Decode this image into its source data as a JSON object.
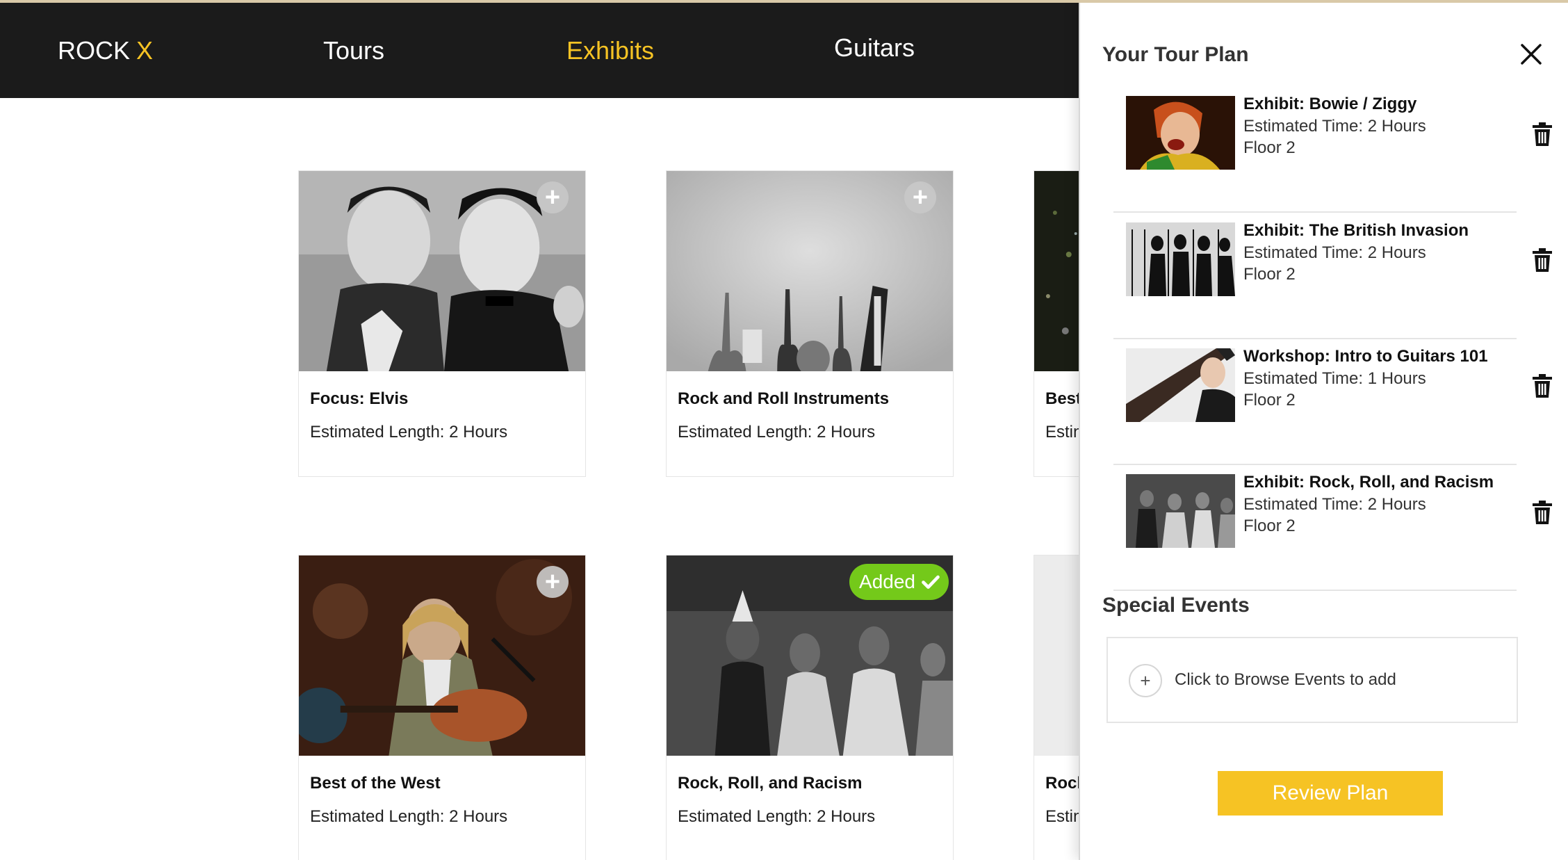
{
  "nav": {
    "logo_text": "ROCK",
    "logo_accent": "X",
    "items": [
      "Tours",
      "Exhibits",
      "Guitars"
    ],
    "active": "Exhibits",
    "accent_color": "#f6c324"
  },
  "cards": [
    {
      "title": "Focus: Elvis",
      "length": "Estimated Length: 2 Hours",
      "status": "add",
      "icon": "plus-icon"
    },
    {
      "title": "Rock and Roll Instruments",
      "length": "Estimated Length: 2 Hours",
      "status": "add",
      "icon": "plus-icon"
    },
    {
      "title": "Best",
      "length": "Estin",
      "status": "add"
    },
    {
      "title": "Best of the West",
      "length": "Estimated Length: 2 Hours",
      "status": "add",
      "icon": "plus-icon"
    },
    {
      "title": "Rock, Roll, and Racism",
      "length": "Estimated Length: 2 Hours",
      "status": "added",
      "added_label": "Added",
      "icon": "check-icon",
      "added_color": "#74c91a"
    },
    {
      "title": "Rock",
      "length": "Estin",
      "status": "add"
    }
  ],
  "drawer": {
    "title": "Your Tour Plan",
    "close_icon": "close-icon",
    "plan_items": [
      {
        "title": "Exhibit: Bowie / Ziggy",
        "time": "Estimated Time: 2 Hours",
        "floor": "Floor 2",
        "icon": "trash-icon"
      },
      {
        "title": "Exhibit: The British Invasion",
        "time": "Estimated Time: 2 Hours",
        "floor": "Floor 2",
        "icon": "trash-icon"
      },
      {
        "title": "Workshop: Intro to Guitars 101",
        "time": "Estimated Time: 1 Hours",
        "floor": "Floor 2",
        "icon": "trash-icon"
      },
      {
        "title": "Exhibit: Rock, Roll, and Racism",
        "time": "Estimated Time: 2 Hours",
        "floor": "Floor 2",
        "icon": "trash-icon"
      }
    ],
    "special_events_title": "Special Events",
    "browse_plus": "+",
    "browse_label": "Click to Browse Events to add",
    "review_label": "Review Plan"
  }
}
